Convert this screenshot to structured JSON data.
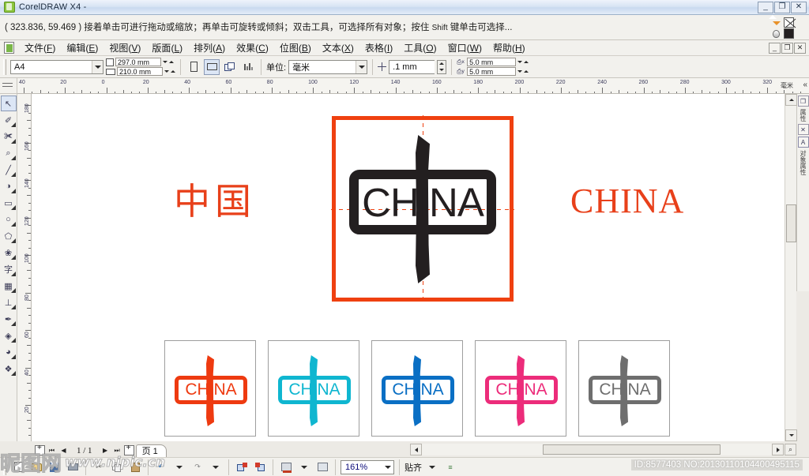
{
  "window": {
    "title": "CorelDRAW X4 -",
    "app_icon": "coreldraw-icon",
    "minimize": "_",
    "maximize": "❐",
    "close": "✕"
  },
  "hint": {
    "coordinates": "( 323.836, 59.469 )",
    "message": "接着单击可进行拖动或缩放；再单击可旋转或倾斜；双击工具，可选择所有对象；按住",
    "message_tail": "键单击可选择...",
    "shift_key": "Shift",
    "fill_swatch": "none",
    "outline_swatch": "#231f20"
  },
  "menu": {
    "items": [
      {
        "label": "文件",
        "accel": "F"
      },
      {
        "label": "编辑",
        "accel": "E"
      },
      {
        "label": "视图",
        "accel": "V"
      },
      {
        "label": "版面",
        "accel": "L"
      },
      {
        "label": "排列",
        "accel": "A"
      },
      {
        "label": "效果",
        "accel": "C"
      },
      {
        "label": "位图",
        "accel": "B"
      },
      {
        "label": "文本",
        "accel": "X"
      },
      {
        "label": "表格",
        "accel": "I"
      },
      {
        "label": "工具",
        "accel": "O"
      },
      {
        "label": "窗口",
        "accel": "W"
      },
      {
        "label": "帮助",
        "accel": "H"
      }
    ],
    "doc_minimize": "_",
    "doc_restore": "❐",
    "doc_close": "✕"
  },
  "propbar": {
    "paper_size": "A4",
    "width_value": "297.0 mm",
    "height_value": "210.0 mm",
    "orientation_portrait": "portrait-icon",
    "orientation_landscape": "landscape-icon",
    "page_all_icon": "all-pages-icon",
    "page_current_icon": "current-page-icon",
    "unit_label": "单位:",
    "unit_value": "毫米",
    "nudge_value": ".1 mm",
    "duplicate_x_label": "x",
    "duplicate_x_value": "5.0 mm",
    "duplicate_y_label": "y",
    "duplicate_y_value": "5.0 mm"
  },
  "rulers": {
    "horizontal_ticks": [
      "40",
      "20",
      "0",
      "20",
      "40",
      "60",
      "80",
      "100",
      "120",
      "140",
      "160",
      "180",
      "200",
      "220",
      "240",
      "260",
      "280",
      "300",
      "320"
    ],
    "vertical_ticks": [
      "180",
      "160",
      "140",
      "120",
      "100",
      "80",
      "60",
      "40",
      "20"
    ],
    "unit": "毫米",
    "collapse_icon": "«"
  },
  "toolbox": {
    "tools": [
      {
        "name": "pick-tool",
        "glyph": "↖",
        "active": true
      },
      {
        "name": "shape-tool",
        "glyph": "✐",
        "active": false
      },
      {
        "name": "crop-tool",
        "glyph": "✀",
        "active": false
      },
      {
        "name": "zoom-tool",
        "glyph": "⌕",
        "active": false
      },
      {
        "name": "freehand-tool",
        "glyph": "╱",
        "active": false
      },
      {
        "name": "smart-fill-tool",
        "glyph": "◑",
        "active": false
      },
      {
        "name": "rectangle-tool",
        "glyph": "▭",
        "active": false
      },
      {
        "name": "ellipse-tool",
        "glyph": "○",
        "active": false
      },
      {
        "name": "polygon-tool",
        "glyph": "⬠",
        "active": false
      },
      {
        "name": "basic-shapes-tool",
        "glyph": "❀",
        "active": false
      },
      {
        "name": "text-tool",
        "glyph": "字",
        "active": false
      },
      {
        "name": "table-tool",
        "glyph": "▦",
        "active": false
      },
      {
        "name": "dimension-tool",
        "glyph": "⊥",
        "active": false
      },
      {
        "name": "blend-tool",
        "glyph": "✒",
        "active": false
      },
      {
        "name": "outline-tool",
        "glyph": "◈",
        "active": false
      },
      {
        "name": "fill-tool",
        "glyph": "◕",
        "active": false
      },
      {
        "name": "interactive-fill-tool",
        "glyph": "❖",
        "active": false
      }
    ]
  },
  "docker": {
    "restore_icon": "❐",
    "close_icon": "✕",
    "label_top": "属性",
    "label_bottom": "对象属性"
  },
  "artwork": {
    "cn_text": "中国",
    "en_text": "CHINA",
    "logo_word": "CHINA",
    "frame_color": "#ef4010",
    "mark_color": "#231f20",
    "text_color": "#e8401a",
    "variants": [
      {
        "name": "orange-red",
        "color": "#ee3a10",
        "word": "CHINA"
      },
      {
        "name": "cyan",
        "color": "#0fb6d0",
        "word": "CHINA"
      },
      {
        "name": "blue",
        "color": "#0a6fc4",
        "word": "CHINA"
      },
      {
        "name": "magenta-pink",
        "color": "#ec2c7a",
        "word": "CHINA"
      },
      {
        "name": "gray",
        "color": "#6e6e6e",
        "word": "CHINA"
      }
    ]
  },
  "pagenav": {
    "first": "⏮",
    "prev": "◀",
    "page_count": "1 / 1",
    "next": "▶",
    "last": "⏭",
    "add_page": "+",
    "tab_label": "页 1"
  },
  "statusbar": {
    "new_icon": "new-document-icon",
    "open_icon": "open-document-icon",
    "save_icon": "save-icon",
    "print_icon": "print-icon",
    "cut_icon": "cut-icon",
    "copy_icon": "copy-icon",
    "paste_icon": "paste-icon",
    "undo_icon": "undo-icon",
    "redo_icon": "redo-icon",
    "import_icon": "import-icon",
    "export_icon": "export-icon",
    "app_launcher_icon": "application-launcher-icon",
    "bitmap_icon": "bitmap-icon",
    "zoom_level": "161%",
    "snap_label": "贴齐",
    "options_icon": "options-icon"
  },
  "watermark": {
    "brand": "昵图网",
    "url": "www.nipic.cn",
    "id_text": "ID:8577403 NO:20130110104400495115"
  }
}
